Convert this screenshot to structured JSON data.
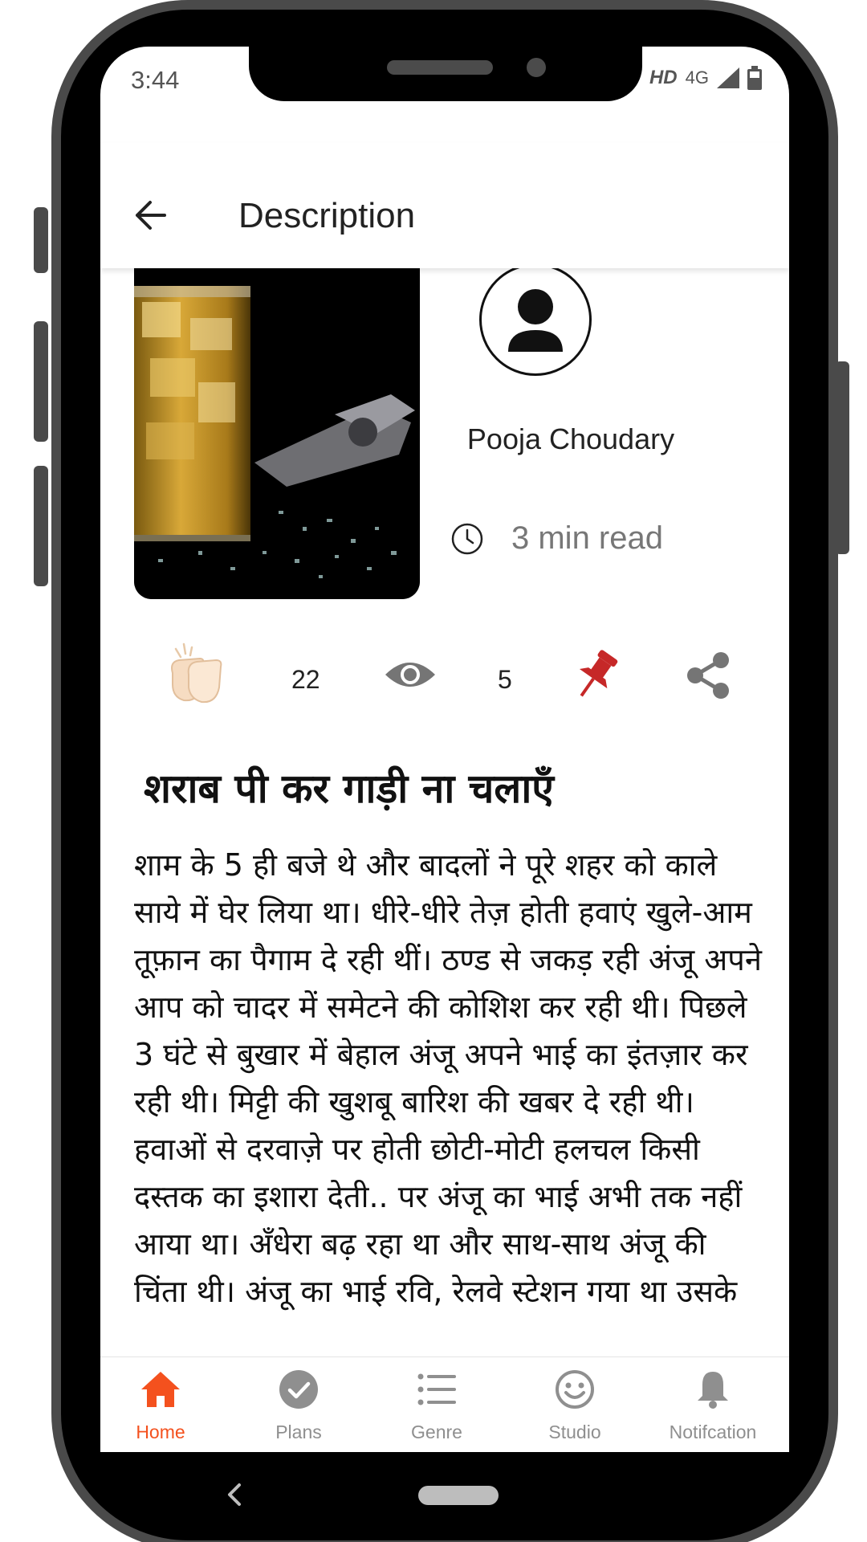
{
  "status_bar": {
    "time": "3:44",
    "hd": "HD",
    "network": "4G"
  },
  "app_bar": {
    "title": "Description"
  },
  "story": {
    "author": "Pooja Choudary",
    "read_time": "3 min read",
    "claps": "22",
    "views": "5",
    "title": "शराब पी कर गाड़ी ना चलाएँ",
    "body": " शाम के 5 ही बजे थे और बादलों ने पूरे शहर को काले साये में घेर लिया था। धीरे-धीरे तेज़ होती हवाएं खुले-आम तूफ़ान का पैगाम दे रही थीं। ठण्ड से जकड़ रही अंजू अपने आप को चादर में समेटने की कोशिश कर रही थी। पिछले 3 घंटे से बुखार में बेहाल अंजू अपने भाई का इंतज़ार कर रही थी। मिट्टी की खुशबू बारिश की खबर दे रही थी। हवाओं से दरवाज़े पर होती छोटी-मोटी हलचल किसी दस्तक का इशारा देती.. पर अंजू का भाई अभी तक नहीं आया था। अँधेरा बढ़ रहा था और साथ-साथ अंजू की चिंता थी। अंजू का भाई रवि, रेलवे स्टेशन गया था उसके"
  },
  "bottom_nav": [
    {
      "label": "Home",
      "icon": "home-icon",
      "active": true
    },
    {
      "label": "Plans",
      "icon": "check-circle-icon",
      "active": false
    },
    {
      "label": "Genre",
      "icon": "list-icon",
      "active": false
    },
    {
      "label": "Studio",
      "icon": "smiley-icon",
      "active": false
    },
    {
      "label": "Notifcation",
      "icon": "bell-icon",
      "active": false
    }
  ],
  "colors": {
    "accent": "#f4511e",
    "pin": "#c62828",
    "inactive": "#8f8f8f"
  }
}
